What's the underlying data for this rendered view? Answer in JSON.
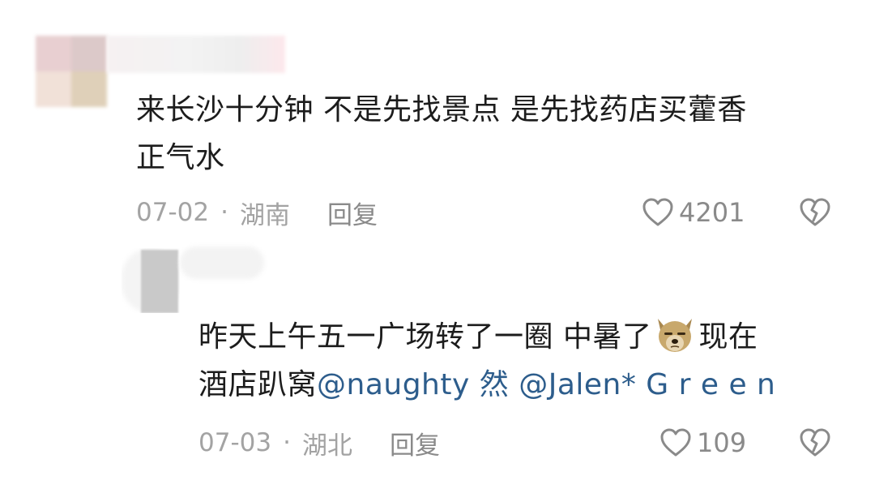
{
  "comment": {
    "text_line1": "来长沙十分钟 不是先找景点 是先找药店买藿香",
    "text_line2": "正气水",
    "date": "07-02",
    "separator": "·",
    "location": "湖南",
    "reply_label": "回复",
    "like_count": "4201"
  },
  "reply": {
    "text_line1_a": "昨天上午五一广场转了一圈 中暑了",
    "emoji": "dog-face-emoji",
    "text_line1_b": "现在",
    "text_line2_prefix": "酒店趴窝",
    "mention_1": "@naughty 然",
    "mention_2": "@Jalen* G r e e n",
    "date": "07-03",
    "separator": "·",
    "location": "湖北",
    "reply_label": "回复",
    "like_count": "109"
  },
  "icons": {
    "like": "heart-outline-icon",
    "dislike": "broken-heart-icon"
  },
  "colors": {
    "text": "#1c1c1c",
    "meta": "#a3a3a3",
    "mention": "#2d5d8c",
    "background": "#ffffff"
  }
}
